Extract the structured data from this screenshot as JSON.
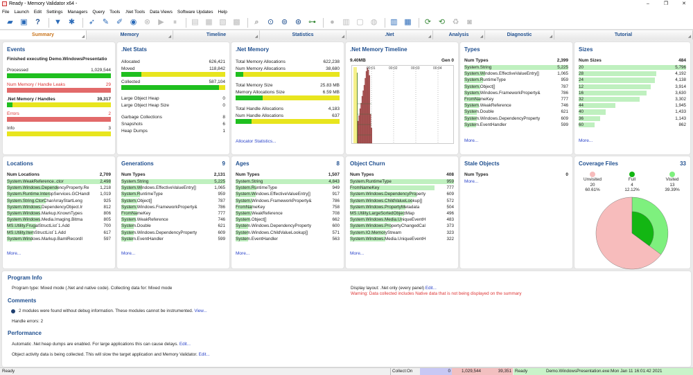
{
  "window": {
    "title": "Ready - Memory Validator x64 -",
    "min": "–",
    "max": "❐",
    "close": "✕"
  },
  "menu": [
    "File",
    "Launch",
    "Edit",
    "Settings",
    "Managers",
    "Query",
    "Tools",
    ".Net Tools",
    "Data Views",
    "Software Updates",
    "Help"
  ],
  "toolbar_icons": [
    "open-icon",
    "save-icon",
    "help-icon",
    "filter-icon",
    "settings-icon",
    "launch-icon",
    "inject-icon",
    "wait-icon",
    "monitor-icon",
    "stop-icon",
    "play-icon",
    "pause-icon",
    "doc-icon",
    "heap-icon",
    "snapshot-icon",
    "archive-icon",
    "search-icon",
    "find-object-icon",
    "find-address-icon",
    "query-icon",
    "tree-icon",
    "leak-icon",
    "dotnet-icon",
    "gc-icon",
    "refresh-icon",
    "timeline-icon",
    "grid-icon",
    "list-icon",
    "reload-icon",
    "recycle-icon",
    "camera-icon"
  ],
  "tabs": [
    "Summary",
    "Memory",
    "Timeline",
    "Statistics",
    ".Net",
    "Analysis",
    "Diagnostic",
    "Tutorial"
  ],
  "events": {
    "title": "Events",
    "status": "Finished executing Demo.WindowsPresentatio",
    "processed_label": "Processed",
    "processed": "1,029,544",
    "leaks_label": "Num Memory / Handle Leaks",
    "leaks": "29",
    "handles_label": ".Net Memory / Handles",
    "handles": "39,317",
    "errors_label": "Errors",
    "errors": "2",
    "info_label": "Info",
    "info": "3"
  },
  "netstats": {
    "title": ".Net Stats",
    "allocated_label": "Allocated",
    "allocated": "626,421",
    "moved_label": "Moved",
    "moved": "118,842",
    "collected_label": "Collected",
    "collected": "587,104",
    "loh_label": "Large Object Heap",
    "loh": "0",
    "lohs_label": "Large Object Heap Size",
    "lohs": "0",
    "gc_label": "Garbage Collections",
    "gc": "8",
    "snap_label": "Snapshots",
    "snap": "6",
    "heap_label": "Heap Dumps",
    "heap": "1"
  },
  "netmem": {
    "title": ".Net Memory",
    "tma_label": "Total Memory Allocations",
    "tma": "622,238",
    "nma_label": "Num Memory Allocations",
    "nma": "38,680",
    "tms_label": "Total Memory Size",
    "tms": "25.83 MB",
    "mas_label": "Memory Allocations Size",
    "mas": "6.59 MB",
    "tha_label": "Total Handle Allocations",
    "tha": "4,183",
    "nha_label": "Num Handle Allocations",
    "nha": "637",
    "link": "Allocator Statistics..."
  },
  "timeline": {
    "title": ".Net Memory Timeline",
    "size": "9.40MB",
    "gen": "Gen 0",
    "ticks": [
      "00:01",
      "00:02",
      "00:03",
      "00:04"
    ]
  },
  "types": {
    "title": "Types",
    "header": "Num Types",
    "count": "2,399",
    "items": [
      {
        "name": "System.String",
        "value": "5,225",
        "pct": 100
      },
      {
        "name": "System.Windows.EffectiveValueEntry[]",
        "value": "1,065",
        "pct": 20
      },
      {
        "name": "System.RuntimeType",
        "value": "959",
        "pct": 18
      },
      {
        "name": "System.Object[]",
        "value": "787",
        "pct": 15
      },
      {
        "name": "System.Windows.FrameworkProperty&",
        "value": "786",
        "pct": 15
      },
      {
        "name": "FromNameKey",
        "value": "777",
        "pct": 15
      },
      {
        "name": "System.WeakReference",
        "value": "746",
        "pct": 14
      },
      {
        "name": "System.Double",
        "value": "621",
        "pct": 12
      },
      {
        "name": "System.Windows.DependencyProperty",
        "value": "609",
        "pct": 12
      },
      {
        "name": "System.EventHandler",
        "value": "599",
        "pct": 11
      }
    ],
    "more": "More..."
  },
  "sizes": {
    "title": "Sizes",
    "header": "Num Sizes",
    "count": "484",
    "items": [
      {
        "name": "20",
        "value": "5,796",
        "pct": 100
      },
      {
        "name": "28",
        "value": "4,192",
        "pct": 72
      },
      {
        "name": "24",
        "value": "4,138",
        "pct": 71
      },
      {
        "name": "12",
        "value": "3,914",
        "pct": 67
      },
      {
        "name": "16",
        "value": "3,630",
        "pct": 63
      },
      {
        "name": "32",
        "value": "3,302",
        "pct": 57
      },
      {
        "name": "44",
        "value": "1,945",
        "pct": 34
      },
      {
        "name": "40",
        "value": "1,433",
        "pct": 25
      },
      {
        "name": "36",
        "value": "1,143",
        "pct": 20
      },
      {
        "name": "60",
        "value": "862",
        "pct": 15
      }
    ],
    "more": "More..."
  },
  "locations": {
    "title": "Locations",
    "header": "Num Locations",
    "count": "2,709",
    "items": [
      {
        "name": "System.WeakReference..ctor",
        "value": "2,498",
        "pct": 100
      },
      {
        "name": "System.Windows.DependencyProperty.Re",
        "value": "1,218",
        "pct": 49
      },
      {
        "name": "System.Runtime.InteropServices.GCHandl",
        "value": "1,019",
        "pct": 41
      },
      {
        "name": "System.String.CtorCharArrayStartLeng",
        "value": "925",
        "pct": 37
      },
      {
        "name": "System.Windows.DependencyObject.Ir",
        "value": "812",
        "pct": 33
      },
      {
        "name": "System.Windows.Markup.KnownTypes",
        "value": "806",
        "pct": 32
      },
      {
        "name": "System.Windows.Media.Imaging.Bitma",
        "value": "805",
        "pct": 32
      },
      {
        "name": "MS.Utility.FrugalStructList`1.Add",
        "value": "700",
        "pct": 28
      },
      {
        "name": "MS.Utility.ItemStructList`1.Add",
        "value": "617",
        "pct": 25
      },
      {
        "name": "System.Windows.Markup.BamlRecordI",
        "value": "597",
        "pct": 24
      }
    ],
    "more": "More..."
  },
  "generations": {
    "title": "Generations",
    "header": "Num Types",
    "count": "2,131",
    "badge": "9",
    "items": [
      {
        "name": "System.String",
        "value": "5,225",
        "pct": 100
      },
      {
        "name": "System.Windows.EffectiveValueEntry[]",
        "value": "1,065",
        "pct": 20
      },
      {
        "name": "System.RuntimeType",
        "value": "959",
        "pct": 18
      },
      {
        "name": "System.Object[]",
        "value": "787",
        "pct": 15
      },
      {
        "name": "System.Windows.FrameworkProperty&",
        "value": "786",
        "pct": 15
      },
      {
        "name": "FromNameKey",
        "value": "777",
        "pct": 15
      },
      {
        "name": "System.WeakReference",
        "value": "746",
        "pct": 14
      },
      {
        "name": "System.Double",
        "value": "621",
        "pct": 12
      },
      {
        "name": "System.Windows.DependencyProperty",
        "value": "609",
        "pct": 12
      },
      {
        "name": "System.EventHandler",
        "value": "599",
        "pct": 11
      }
    ],
    "more": "More..."
  },
  "ages": {
    "title": "Ages",
    "header": "Num Types",
    "count": "1,507",
    "badge": "8",
    "items": [
      {
        "name": "System.String",
        "value": "4,843",
        "pct": 100
      },
      {
        "name": "System.RuntimeType",
        "value": "949",
        "pct": 20
      },
      {
        "name": "System.Windows.EffectiveValueEntry[]",
        "value": "917",
        "pct": 19
      },
      {
        "name": "System.Windows.FrameworkProperty&",
        "value": "786",
        "pct": 16
      },
      {
        "name": "FromNameKey",
        "value": "758",
        "pct": 16
      },
      {
        "name": "System.WeakReference",
        "value": "708",
        "pct": 15
      },
      {
        "name": "System.Object[]",
        "value": "662",
        "pct": 14
      },
      {
        "name": "System.Windows.DependencyProperty",
        "value": "600",
        "pct": 12
      },
      {
        "name": "System.Windows.ChildValueLookup[]",
        "value": "571",
        "pct": 12
      },
      {
        "name": "System.EventHandler",
        "value": "563",
        "pct": 12
      }
    ],
    "more": "More..."
  },
  "churn": {
    "title": "Object Churn",
    "header": "Num Types",
    "count": "408",
    "items": [
      {
        "name": "System.RuntimeType",
        "value": "959",
        "pct": 100
      },
      {
        "name": "FromNameKey",
        "value": "777",
        "pct": 81
      },
      {
        "name": "System.Windows.DependencyProperty",
        "value": "609",
        "pct": 64
      },
      {
        "name": "System.Windows.ChildValueLookup[]",
        "value": "572",
        "pct": 60
      },
      {
        "name": "System.Windows.PropertyMetadata",
        "value": "504",
        "pct": 53
      },
      {
        "name": "MS.Utility.LargeSortedObjectMap",
        "value": "496",
        "pct": 52
      },
      {
        "name": "System.Windows.Media.UniqueEventH",
        "value": "483",
        "pct": 50
      },
      {
        "name": "System.Windows.PropertyChangedCal",
        "value": "373",
        "pct": 39
      },
      {
        "name": "System.IO.MemoryStream",
        "value": "323",
        "pct": 34
      },
      {
        "name": "System.Windows.Media.UniqueEventH",
        "value": "322",
        "pct": 34
      }
    ],
    "more": "More..."
  },
  "stale": {
    "title": "Stale Objects",
    "header": "Num Types",
    "count": "0",
    "more": "More..."
  },
  "coverage": {
    "title": "Coverage Files",
    "count": "33",
    "unvisited_label": "Unvisited",
    "unvisited": "20",
    "unvisited_pct": "60.61%",
    "full_label": "Full",
    "full": "4",
    "full_pct": "12.12%",
    "visited_label": "Visited",
    "visited": "13",
    "visited_pct": "39.39%"
  },
  "chart_data": {
    "type": "pie",
    "categories": [
      "Unvisited",
      "Full",
      "Visited"
    ],
    "values": [
      20,
      4,
      13
    ],
    "colors": [
      "#f7bcbc",
      "#13b613",
      "#7ef07e"
    ]
  },
  "program": {
    "info_title": "Program Info",
    "info_text": "Program type: Mixed mode (.Net and native code). Collecting data for: Mixed mode",
    "layout_text": "Display layout: .Net only (every panel)",
    "layout_link": "Edit...",
    "warning": "Warning: Data collected includes Native data that is not being displayed on the summary",
    "comments_title": "Comments",
    "comment1": "2 modules were found without debug information. These modules cannot be instrumented.",
    "comment1_link": "View...",
    "comment2": "Handle errors: 2",
    "perf_title": "Performance",
    "perf1": "Automatic .Net heap dumps are enabled. For large applications this can cause delays.",
    "perf1_link": "Edit...",
    "perf2": "Object activity data is being collected. This will slow the target application and Memory Validator.",
    "perf2_link": "Edit..."
  },
  "statusbar": {
    "left": "Ready",
    "collect": "Collect:On",
    "v1": "0",
    "v2": "1,029,544",
    "v3": "39,351",
    "ready": "Ready",
    "info": "Demo.WindowsPresentation.exe:Mon Jan 11 16:01:42 2021"
  }
}
